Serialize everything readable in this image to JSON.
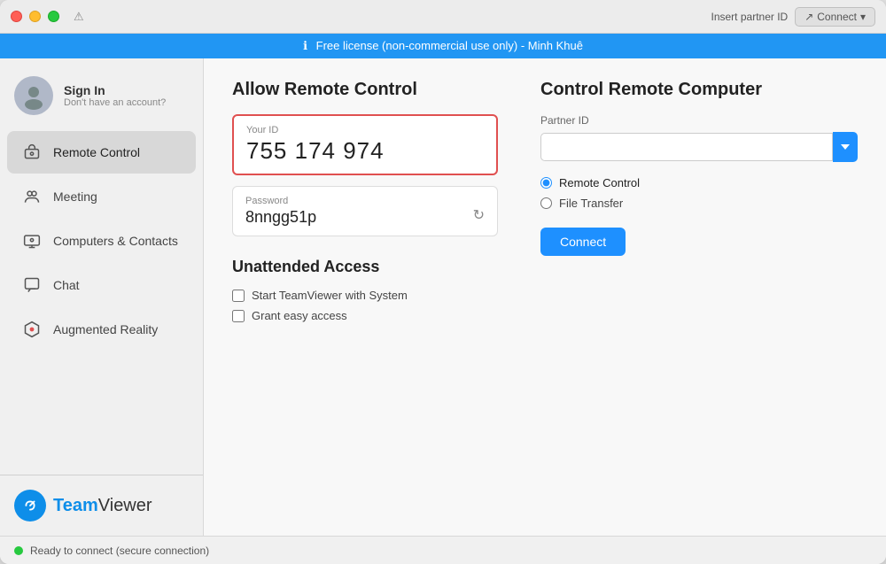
{
  "window": {
    "title": "TeamViewer"
  },
  "titlebar": {
    "warning_icon": "⚠",
    "insert_partner_label": "Insert partner ID",
    "connect_label": "Connect",
    "connect_arrow": "↗"
  },
  "banner": {
    "info_icon": "ℹ",
    "message": "Free license (non-commercial use only) - Minh Khuê"
  },
  "sidebar": {
    "profile": {
      "name": "Sign In",
      "sub": "Don't have an account?"
    },
    "items": [
      {
        "id": "remote-control",
        "label": "Remote Control",
        "active": true
      },
      {
        "id": "meeting",
        "label": "Meeting",
        "active": false
      },
      {
        "id": "computers-contacts",
        "label": "Computers & Contacts",
        "active": false
      },
      {
        "id": "chat",
        "label": "Chat",
        "active": false
      },
      {
        "id": "augmented-reality",
        "label": "Augmented Reality",
        "active": false
      }
    ],
    "brand": {
      "name_bold": "Team",
      "name_light": "Viewer"
    }
  },
  "allow_remote": {
    "title": "Allow Remote Control",
    "your_id_label": "Your ID",
    "your_id_value": "755 174 974",
    "password_label": "Password",
    "password_value": "8nngg51p"
  },
  "unattended": {
    "title": "Unattended Access",
    "option1": "Start TeamViewer with System",
    "option2": "Grant easy access"
  },
  "control_remote": {
    "title": "Control Remote Computer",
    "partner_id_label": "Partner ID",
    "partner_id_placeholder": "",
    "radio_options": [
      {
        "id": "remote-control-radio",
        "label": "Remote Control",
        "checked": true
      },
      {
        "id": "file-transfer-radio",
        "label": "File Transfer",
        "checked": false
      }
    ],
    "connect_button": "Connect"
  },
  "statusbar": {
    "status_text": "Ready to connect (secure connection)"
  }
}
